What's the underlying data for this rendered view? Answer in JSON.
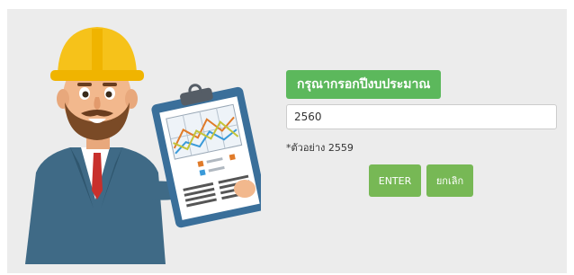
{
  "form": {
    "title": "กรุณากรอกปีงบประมาณ",
    "year_value": "2560",
    "example_text": "*ตัวอย่าง 2559",
    "enter_label": "ENTER",
    "cancel_label": "ยกเลิก"
  },
  "colors": {
    "accent_green": "#5cb85c",
    "button_green": "#77b855",
    "panel_bg": "#ececec"
  },
  "illustration": {
    "icon": "construction-worker-with-clipboard-illustration"
  }
}
